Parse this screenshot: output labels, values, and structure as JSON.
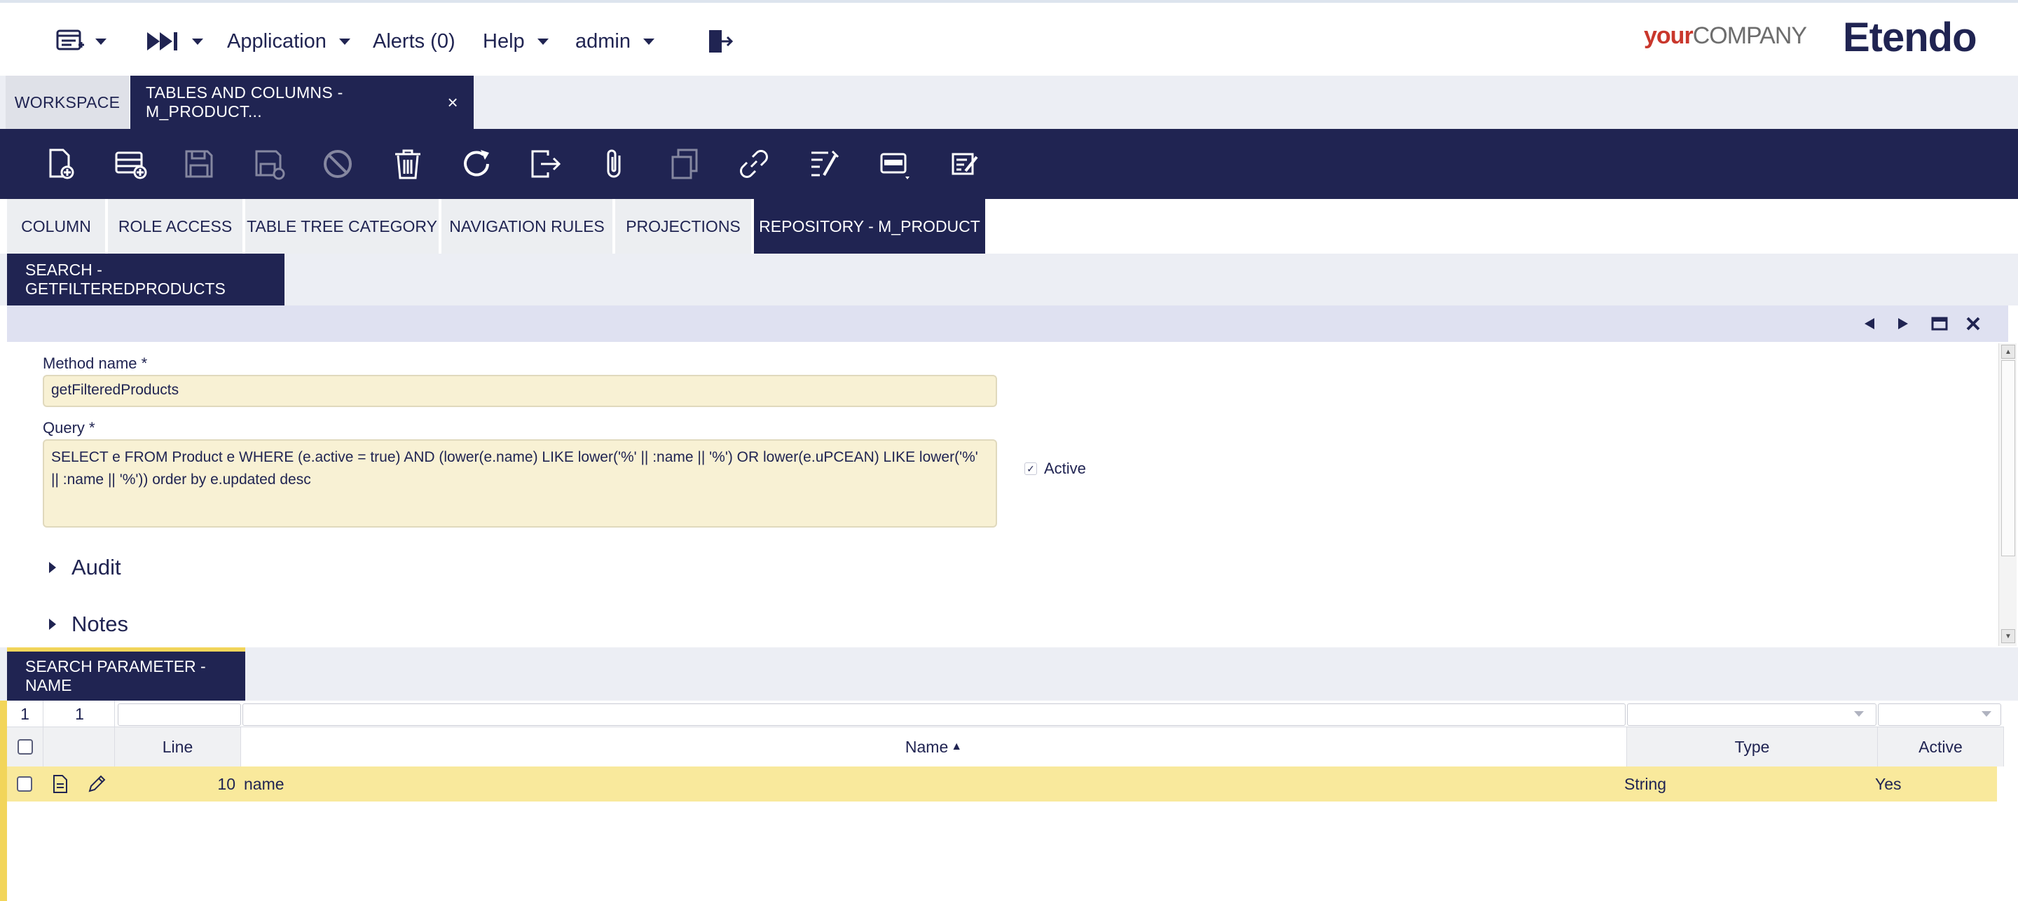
{
  "topbar": {
    "application_label": "Application",
    "alerts_label": "Alerts (0)",
    "help_label": "Help",
    "user_label": "admin",
    "logo_company_your": "your",
    "logo_company_rest": "COMPANY",
    "logo_brand": "Etendo"
  },
  "main_tabs": {
    "workspace": "WORKSPACE",
    "active": "TABLES AND COLUMNS - M_PRODUCT...",
    "close_symbol": "×"
  },
  "toolbar": {
    "icons": [
      "new-document-icon",
      "new-row-icon",
      "save-icon",
      "save-close-icon",
      "cancel-icon",
      "delete-icon",
      "refresh-icon",
      "export-icon",
      "attach-icon",
      "copy-record-icon",
      "link-icon",
      "audit-tools-icon",
      "grid-toggle-icon",
      "notes-icon"
    ]
  },
  "sub_tabs": [
    "COLUMN",
    "ROLE ACCESS",
    "TABLE TREE CATEGORY",
    "NAVIGATION RULES",
    "PROJECTIONS",
    "REPOSITORY - M_PRODUCT"
  ],
  "search_section": {
    "title": "SEARCH - GETFILTEREDPRODUCTS"
  },
  "form": {
    "method_name_label": "Method name *",
    "method_name_value": "getFilteredProducts",
    "query_label": "Query *",
    "query_value": "SELECT e FROM Product e WHERE (e.active = true) AND (lower(e.name)  LIKE lower('%' || :name || '%') OR lower(e.uPCEAN)  LIKE  lower('%' || :name || '%')) order by e.updated desc",
    "active_label": "Active",
    "active_checked": true,
    "audit_label": "Audit",
    "notes_label": "Notes"
  },
  "param_section": {
    "title": "SEARCH PARAMETER - NAME"
  },
  "grid": {
    "filter_count_a": "1",
    "filter_count_b": "1",
    "columns": {
      "line": "Line",
      "name": "Name",
      "name_sort": "▲",
      "type": "Type",
      "active": "Active"
    },
    "rows": [
      {
        "line": "10",
        "name": "name",
        "type": "String",
        "active": "Yes"
      }
    ]
  },
  "colors": {
    "navy": "#202452",
    "field_bg": "#f8f1d4",
    "selected_row": "#f9e99c",
    "accent_yellow": "#f2d55a"
  }
}
